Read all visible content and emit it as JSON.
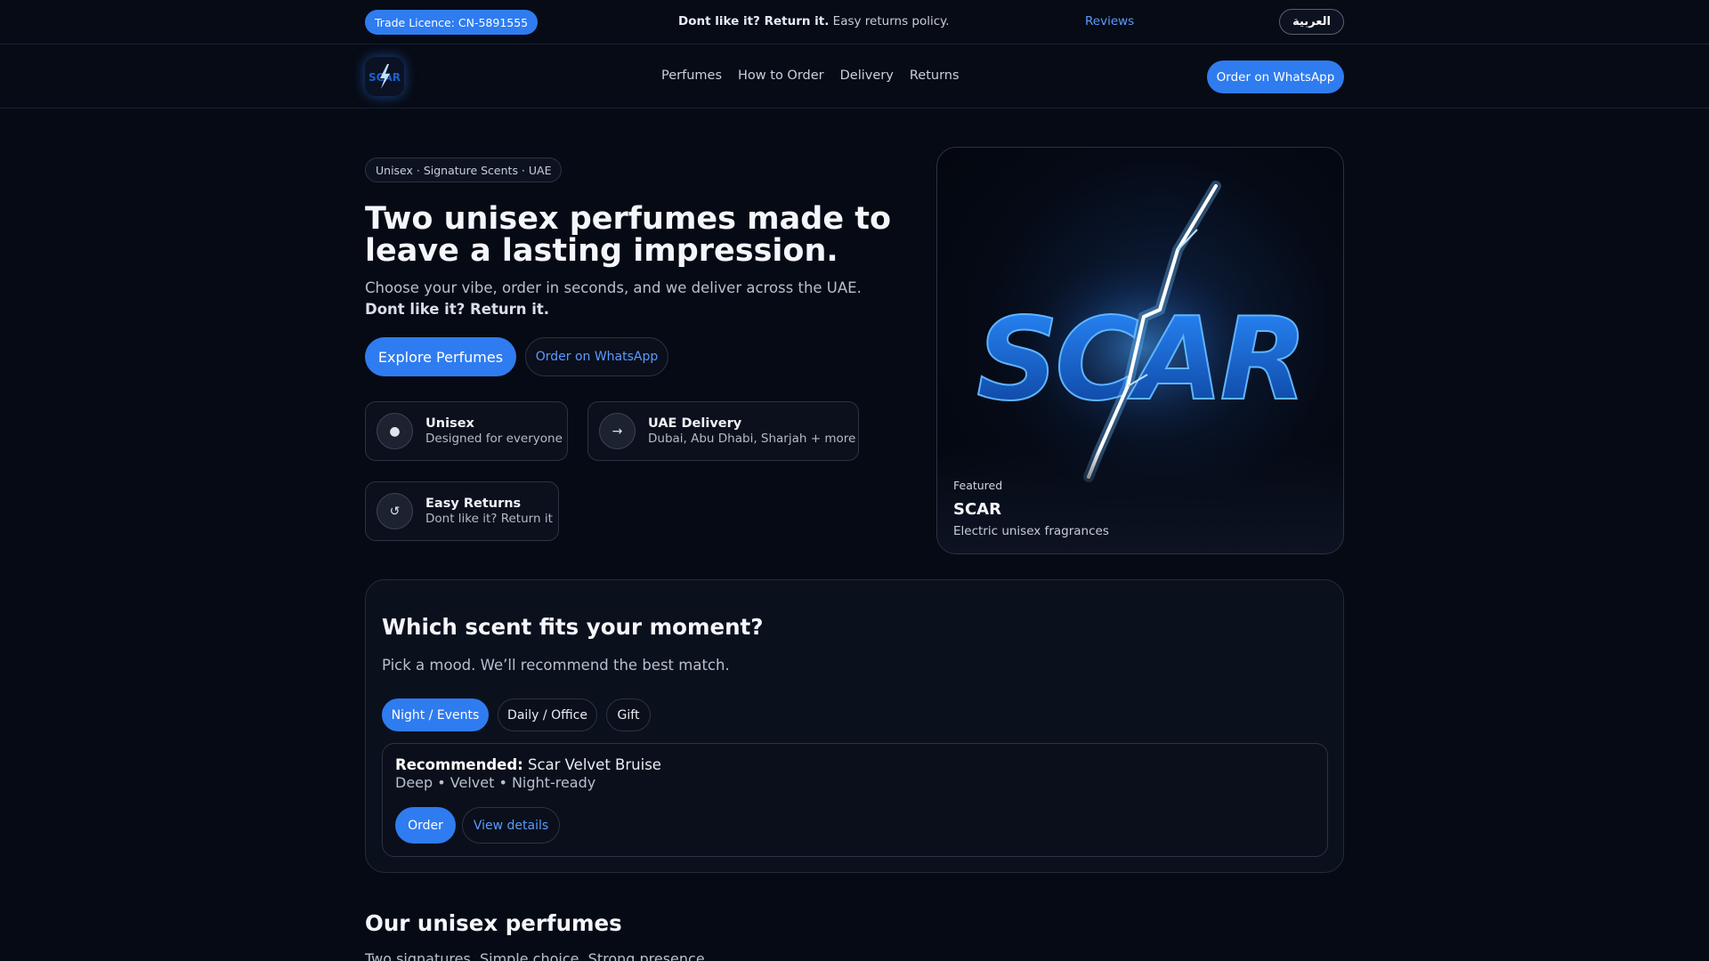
{
  "topbar": {
    "licence": "Trade Licence: CN-5891555",
    "promo_bold": "Dont like it? Return it.",
    "promo_text": " Easy returns policy.",
    "reviews": "Reviews",
    "language": "العربية"
  },
  "nav": {
    "logo_icon": "scar-lightning-logo",
    "links": [
      "Perfumes",
      "How to Order",
      "Delivery",
      "Returns"
    ],
    "cta": "Order on WhatsApp"
  },
  "hero": {
    "tagline": "Unisex · Signature Scents · UAE",
    "title": "Two unisex perfumes made to leave a lasting impression.",
    "subtitle": "Choose your vibe, order in seconds, and we deliver across the UAE. ",
    "subtitle_bold": "Dont like it? Return it.",
    "primary_button": "Explore Perfumes",
    "secondary_button": "Order on WhatsApp",
    "features": [
      {
        "icon": "●",
        "title": "Unisex",
        "desc": "Designed for everyone"
      },
      {
        "icon": "→",
        "title": "UAE Delivery",
        "desc": "Dubai, Abu Dhabi, Sharjah + more"
      },
      {
        "icon": "↺",
        "title": "Easy Returns",
        "desc": "Dont like it? Return it"
      }
    ]
  },
  "featured": {
    "image_text": "SCAR",
    "kicker": "Featured",
    "name": "SCAR",
    "desc": "Electric unisex fragrances"
  },
  "quiz": {
    "title": "Which scent fits your moment?",
    "subtitle": "Pick a mood. We’ll recommend the best match.",
    "chips": [
      "Night / Events",
      "Daily / Office",
      "Gift"
    ],
    "active_chip": "Night / Events",
    "recommended_label": "Recommended:",
    "recommended_name": " Scar Velvet Bruise",
    "recommended_notes": "Deep • Velvet • Night-ready",
    "order_button": "Order",
    "details_button": "View details"
  },
  "products": {
    "title": "Our unisex perfumes",
    "subtitle": "Two signatures. Simple choice. Strong presence."
  },
  "colors": {
    "accent": "#2f7cf0",
    "link": "#5b9bff",
    "background": "#060a14"
  }
}
